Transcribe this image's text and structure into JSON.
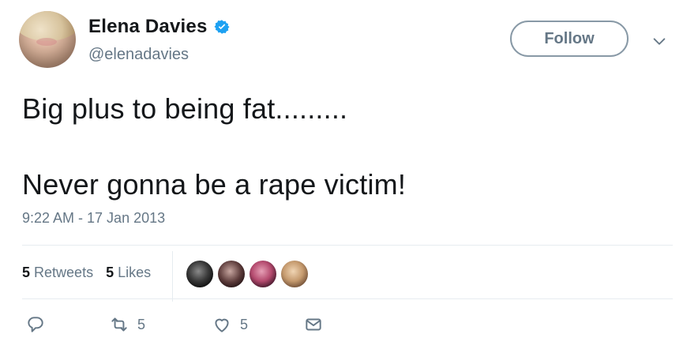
{
  "user": {
    "display_name": "Elena Davies",
    "handle": "@elenadavies",
    "verified": true
  },
  "header": {
    "follow_label": "Follow"
  },
  "tweet": {
    "lines": [
      "Big plus to being fat.........",
      "Never gonna be a rape victim!"
    ],
    "timestamp": "9:22 AM - 17 Jan 2013"
  },
  "stats": {
    "retweets_count": "5",
    "retweets_label": "Retweets",
    "likes_count": "5",
    "likes_label": "Likes"
  },
  "actions": {
    "retweet_count": "5",
    "like_count": "5"
  },
  "colors": {
    "verified_blue": "#1da1f2",
    "muted_gray": "#657786",
    "text": "#14171a"
  },
  "icons": [
    "verified-badge-icon",
    "chevron-down-icon",
    "reply-icon",
    "retweet-icon",
    "like-icon",
    "direct-message-icon"
  ]
}
